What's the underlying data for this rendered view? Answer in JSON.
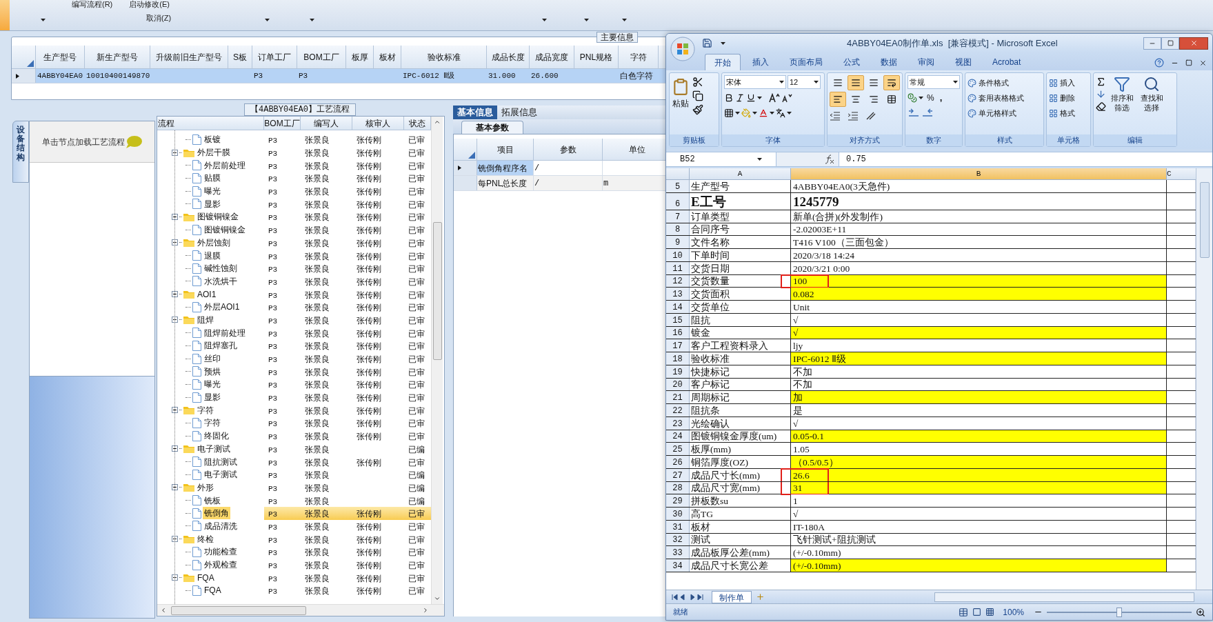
{
  "toolbar": {
    "menu_items": [
      "编写流程(R)",
      "启动修改(E)",
      "取消(Z)"
    ]
  },
  "main_info": {
    "title": "主要信息",
    "columns": [
      "生产型号",
      "新生产型号",
      "升级前旧生产型号",
      "S板",
      "订单工厂",
      "BOM工厂",
      "板厚",
      "板材",
      "验收标准",
      "成品长度",
      "成品宽度",
      "PNL规格",
      "字符"
    ],
    "rows": [
      {
        "selected": true,
        "cells": [
          "4ABBY04EA0",
          "10010400149870",
          null,
          null,
          "P3",
          "P3",
          null,
          null,
          "IPC-6012 Ⅱ级",
          "31.000",
          "26.600",
          null,
          "白色字符"
        ]
      }
    ]
  },
  "side_panel": {
    "tab": {
      "label": "设备结构",
      "selected": true
    },
    "hint": "单击节点加载工艺流程"
  },
  "process": {
    "title": "【4ABBY04EA0】工艺流程",
    "columns": [
      "流程",
      "BOM工厂",
      "编写人",
      "核审人",
      "状态"
    ],
    "tree": [
      {
        "children": [
          {
            "label": "板镀",
            "bom": "P3",
            "writer": "张景良",
            "reviewer": "张传刚",
            "status": "已审",
            "selected": false
          }
        ]
      },
      {
        "label": "外层干膜",
        "expanded": true,
        "bom": "P3",
        "writer": "张景良",
        "reviewer": "张传刚",
        "status": "已审",
        "selected": false,
        "children": [
          {
            "label": "外层前处理",
            "bom": "P3",
            "writer": "张景良",
            "reviewer": "张传刚",
            "status": "已审",
            "selected": false
          },
          {
            "label": "贴膜",
            "bom": "P3",
            "writer": "张景良",
            "reviewer": "张传刚",
            "status": "已审",
            "selected": false
          },
          {
            "label": "曝光",
            "bom": "P3",
            "writer": "张景良",
            "reviewer": "张传刚",
            "status": "已审",
            "selected": false
          },
          {
            "label": "显影",
            "bom": "P3",
            "writer": "张景良",
            "reviewer": "张传刚",
            "status": "已审",
            "selected": false
          }
        ]
      },
      {
        "label": "图镀铜镍金",
        "expanded": true,
        "bom": "P3",
        "writer": "张景良",
        "reviewer": "张传刚",
        "status": "已审",
        "selected": false,
        "children": [
          {
            "label": "图镀铜镍金",
            "bom": "P3",
            "writer": "张景良",
            "reviewer": "张传刚",
            "status": "已审",
            "selected": false
          }
        ]
      },
      {
        "label": "外层蚀刻",
        "expanded": true,
        "bom": "P3",
        "writer": "张景良",
        "reviewer": "张传刚",
        "status": "已审",
        "selected": false,
        "children": [
          {
            "label": "退膜",
            "bom": "P3",
            "writer": "张景良",
            "reviewer": "张传刚",
            "status": "已审",
            "selected": false
          },
          {
            "label": "碱性蚀刻",
            "bom": "P3",
            "writer": "张景良",
            "reviewer": "张传刚",
            "status": "已审",
            "selected": false
          },
          {
            "label": "水洗烘干",
            "bom": "P3",
            "writer": "张景良",
            "reviewer": "张传刚",
            "status": "已审",
            "selected": false
          }
        ]
      },
      {
        "label": "AOI1",
        "expanded": true,
        "bom": "P3",
        "writer": "张景良",
        "reviewer": "张传刚",
        "status": "已审",
        "selected": false,
        "children": [
          {
            "label": "外层AOI1",
            "bom": "P3",
            "writer": "张景良",
            "reviewer": "张传刚",
            "status": "已审",
            "selected": false
          }
        ]
      },
      {
        "label": "阻焊",
        "expanded": true,
        "bom": "P3",
        "writer": "张景良",
        "reviewer": "张传刚",
        "status": "已审",
        "selected": false,
        "children": [
          {
            "label": "阻焊前处理",
            "bom": "P3",
            "writer": "张景良",
            "reviewer": "张传刚",
            "status": "已审",
            "selected": false
          },
          {
            "label": "阻焊塞孔",
            "bom": "P3",
            "writer": "张景良",
            "reviewer": "张传刚",
            "status": "已审",
            "selected": false
          },
          {
            "label": "丝印",
            "bom": "P3",
            "writer": "张景良",
            "reviewer": "张传刚",
            "status": "已审",
            "selected": false
          },
          {
            "label": "预烘",
            "bom": "P3",
            "writer": "张景良",
            "reviewer": "张传刚",
            "status": "已审",
            "selected": false
          },
          {
            "label": "曝光",
            "bom": "P3",
            "writer": "张景良",
            "reviewer": "张传刚",
            "status": "已审",
            "selected": false
          },
          {
            "label": "显影",
            "bom": "P3",
            "writer": "张景良",
            "reviewer": "张传刚",
            "status": "已审",
            "selected": false
          }
        ]
      },
      {
        "label": "字符",
        "expanded": true,
        "bom": "P3",
        "writer": "张景良",
        "reviewer": "张传刚",
        "status": "已审",
        "selected": false,
        "children": [
          {
            "label": "字符",
            "bom": "P3",
            "writer": "张景良",
            "reviewer": "张传刚",
            "status": "已审",
            "selected": false
          },
          {
            "label": "终固化",
            "bom": "P3",
            "writer": "张景良",
            "reviewer": "张传刚",
            "status": "已审",
            "selected": false
          }
        ]
      },
      {
        "label": "电子测试",
        "expanded": true,
        "bom": "P3",
        "writer": "张景良",
        "status": "已编",
        "selected": false,
        "children": [
          {
            "label": "阻抗测试",
            "bom": "P3",
            "writer": "张景良",
            "reviewer": "张传刚",
            "status": "已审",
            "selected": false
          },
          {
            "label": "电子测试",
            "bom": "P3",
            "writer": "张景良",
            "status": "已编",
            "selected": false
          }
        ]
      },
      {
        "label": "外形",
        "expanded": true,
        "bom": "P3",
        "writer": "张景良",
        "status": "已编",
        "selected": false,
        "children": [
          {
            "label": "铣板",
            "bom": "P3",
            "writer": "张景良",
            "status": "已编",
            "selected": false
          },
          {
            "label": "铣倒角",
            "bom": "P3",
            "writer": "张景良",
            "reviewer": "张传刚",
            "status": "已审",
            "selected": true
          },
          {
            "label": "成品清洗",
            "bom": "P3",
            "writer": "张景良",
            "reviewer": "张传刚",
            "status": "已审",
            "selected": false
          }
        ]
      },
      {
        "label": "终检",
        "expanded": true,
        "bom": "P3",
        "writer": "张景良",
        "reviewer": "张传刚",
        "status": "已审",
        "selected": false,
        "children": [
          {
            "label": "功能检查",
            "bom": "P3",
            "writer": "张景良",
            "reviewer": "张传刚",
            "status": "已审",
            "selected": false
          },
          {
            "label": "外观检查",
            "bom": "P3",
            "writer": "张景良",
            "reviewer": "张传刚",
            "status": "已审",
            "selected": false
          }
        ]
      },
      {
        "label": "FQA",
        "expanded": true,
        "bom": "P3",
        "writer": "张景良",
        "reviewer": "张传刚",
        "status": "已审",
        "selected": false,
        "children": [
          {
            "label": "FQA",
            "bom": "P3",
            "writer": "张景良",
            "reviewer": "张传刚",
            "status": "已审",
            "selected": false
          }
        ]
      }
    ]
  },
  "details": {
    "tabs": [
      {
        "label": "基本信息",
        "selected": true
      },
      {
        "label": "拓展信息",
        "selected": false
      }
    ],
    "subtabs": [
      {
        "label": "基本参数",
        "selected": true
      }
    ],
    "columns": [
      "项目",
      "参数",
      "单位"
    ],
    "rows": [
      {
        "selected": true,
        "cells": [
          "铣倒角程序名",
          "/",
          null
        ]
      },
      {
        "selected": false,
        "cells": [
          "每PNL总长度",
          "/",
          "m"
        ]
      }
    ]
  },
  "excel": {
    "title": "4ABBY04EA0制作单.xls  [兼容模式] - Microsoft Excel",
    "ribbon_tabs": [
      {
        "label": "开始",
        "selected": true
      },
      {
        "label": "插入",
        "selected": false
      },
      {
        "label": "页面布局",
        "selected": false
      },
      {
        "label": "公式",
        "selected": false
      },
      {
        "label": "数据",
        "selected": false
      },
      {
        "label": "审阅",
        "selected": false
      },
      {
        "label": "视图",
        "selected": false
      },
      {
        "label": "Acrobat",
        "selected": false
      }
    ],
    "clipboard": {
      "paste": "粘贴",
      "label": "剪贴板"
    },
    "font": {
      "font_name": "宋体",
      "font_size": "12",
      "label": "字体"
    },
    "alignment": {
      "label": "对齐方式",
      "buttons": [
        {
          "kind": "top",
          "selected": false
        },
        {
          "kind": "middle",
          "selected": true
        },
        {
          "kind": "bottom",
          "selected": false
        },
        {
          "kind": "wrap",
          "selected": true
        },
        {
          "kind": "left",
          "selected": true
        },
        {
          "kind": "center",
          "selected": false
        },
        {
          "kind": "right",
          "selected": false
        },
        {
          "kind": "merge",
          "selected": false
        }
      ]
    },
    "number": {
      "format": "常规",
      "percent": "%",
      "comma": ",",
      "label": "数字"
    },
    "styles": {
      "buttons": [
        "条件格式",
        "套用表格格式",
        "单元格样式"
      ],
      "label": "样式"
    },
    "cells": {
      "buttons": [
        "插入",
        "删除",
        "格式"
      ],
      "label": "单元格"
    },
    "editing": {
      "buttons": [
        "排序和筛选",
        "查找和选择"
      ],
      "label": "编辑"
    },
    "name_box": "B52",
    "formula": "0.75",
    "columns": [
      "A",
      "B",
      "C"
    ],
    "rows": [
      {
        "number": "5",
        "label": "生产型号",
        "value": "4ABBY04EA0(3天急件)",
        "highlight": false,
        "annotated": false,
        "emphasis": false
      },
      {
        "number": "6",
        "label": "E工号",
        "value": "1245779",
        "highlight": false,
        "annotated": false,
        "emphasis": true
      },
      {
        "number": "7",
        "label": "订单类型",
        "value": "新单(合拼)(外发制作)",
        "highlight": false,
        "annotated": false,
        "emphasis": false
      },
      {
        "number": "8",
        "label": "合同序号",
        "value": "-2.02003E+11",
        "highlight": false,
        "annotated": false,
        "emphasis": false
      },
      {
        "number": "9",
        "label": "文件名称",
        "value": "T416 V100（三面包金）",
        "highlight": false,
        "annotated": false,
        "emphasis": false
      },
      {
        "number": "10",
        "label": "下单时间",
        "value": "2020/3/18 14:24",
        "highlight": false,
        "annotated": false,
        "emphasis": false
      },
      {
        "number": "11",
        "label": "交货日期",
        "value": "2020/3/21 0:00",
        "highlight": false,
        "annotated": false,
        "emphasis": false
      },
      {
        "number": "12",
        "label": "交货数量",
        "value": "100",
        "highlight": true,
        "annotated": true,
        "emphasis": false
      },
      {
        "number": "13",
        "label": "交货面积",
        "value": "0.082",
        "highlight": true,
        "annotated": false,
        "emphasis": false
      },
      {
        "number": "14",
        "label": "交货单位",
        "value": "Unit",
        "highlight": false,
        "annotated": false,
        "emphasis": false
      },
      {
        "number": "15",
        "label": "阻抗",
        "value": "√",
        "highlight": false,
        "annotated": false,
        "emphasis": false
      },
      {
        "number": "16",
        "label": "镀金",
        "value": "√",
        "highlight": true,
        "annotated": false,
        "emphasis": false
      },
      {
        "number": "17",
        "label": "客户工程资料录入",
        "value": "ljy",
        "highlight": false,
        "annotated": false,
        "emphasis": false
      },
      {
        "number": "18",
        "label": "验收标准",
        "value": "IPC-6012 Ⅱ级",
        "highlight": true,
        "annotated": false,
        "emphasis": false
      },
      {
        "number": "19",
        "label": "快捷标记",
        "value": "不加",
        "highlight": false,
        "annotated": false,
        "emphasis": false
      },
      {
        "number": "20",
        "label": "客户标记",
        "value": "不加",
        "highlight": false,
        "annotated": false,
        "emphasis": false
      },
      {
        "number": "21",
        "label": "周期标记",
        "value": "加",
        "highlight": true,
        "annotated": false,
        "emphasis": false
      },
      {
        "number": "22",
        "label": "阻抗条",
        "value": "是",
        "highlight": false,
        "annotated": false,
        "emphasis": false
      },
      {
        "number": "23",
        "label": "光绘确认",
        "value": "√",
        "highlight": false,
        "annotated": false,
        "emphasis": false
      },
      {
        "number": "24",
        "label": "图镀铜镍金厚度(um)",
        "value": "0.05-0.1",
        "highlight": true,
        "annotated": false,
        "emphasis": false
      },
      {
        "number": "25",
        "label": "板厚(mm)",
        "value": "1.05",
        "highlight": false,
        "annotated": false,
        "emphasis": false
      },
      {
        "number": "26",
        "label": "铜箔厚度(OZ)",
        "value": "（0.5/0.5）",
        "highlight": true,
        "annotated": false,
        "emphasis": false
      },
      {
        "number": "27",
        "label": "成品尺寸长(mm)",
        "value": "26.6",
        "highlight": true,
        "annotated": true,
        "emphasis": false
      },
      {
        "number": "28",
        "label": "成品尺寸宽(mm)",
        "value": "31",
        "highlight": true,
        "annotated": true,
        "emphasis": false
      },
      {
        "number": "29",
        "label": "拼板数su",
        "value": "1",
        "highlight": false,
        "annotated": false,
        "emphasis": false
      },
      {
        "number": "30",
        "label": "高TG",
        "value": "√",
        "highlight": false,
        "annotated": false,
        "emphasis": false
      },
      {
        "number": "31",
        "label": "板材",
        "value": "IT-180A",
        "highlight": false,
        "annotated": false,
        "emphasis": false
      },
      {
        "number": "32",
        "label": "测试",
        "value": "飞针测试+阻抗测试",
        "highlight": false,
        "annotated": false,
        "emphasis": false
      },
      {
        "number": "33",
        "label": "成品板厚公差(mm)",
        "value": "(+/-0.10mm)",
        "highlight": false,
        "annotated": false,
        "emphasis": false
      },
      {
        "number": "34",
        "label": "成品尺寸长宽公差",
        "value": "(+/-0.10mm)",
        "highlight": true,
        "annotated": false,
        "emphasis": false
      }
    ],
    "sheet_tabs": [
      {
        "label": "制作单",
        "selected": true
      }
    ],
    "status": "就绪",
    "zoom": "100%",
    "zoom_slider": {
      "level": 0.5
    }
  }
}
